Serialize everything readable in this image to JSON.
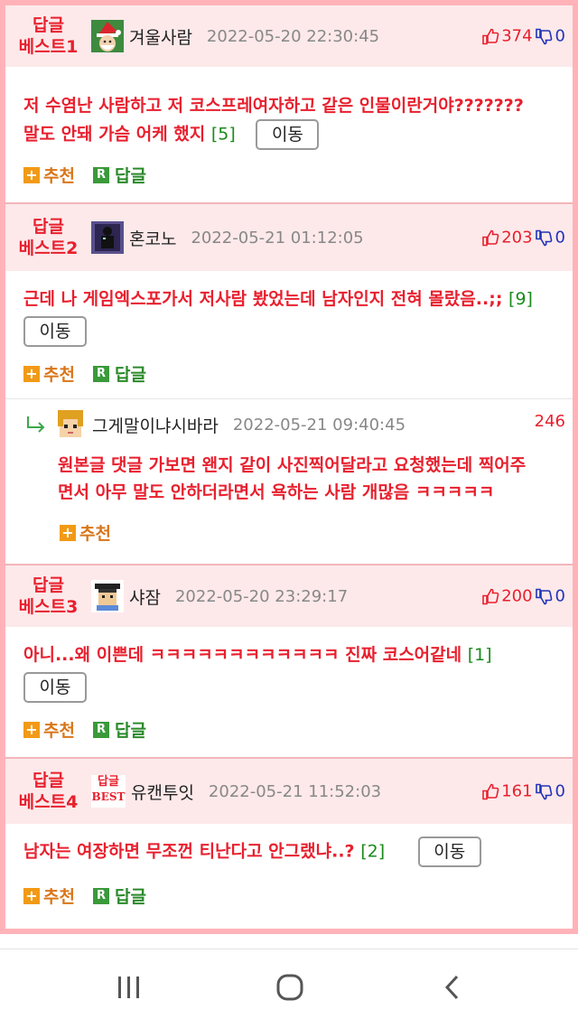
{
  "labels": {
    "recommend": "추천",
    "reply": "답글",
    "move": "이동",
    "r_badge": "R",
    "plus_badge": "+"
  },
  "colors": {
    "frame": "#ffb3b8",
    "header_bg": "#fde9ea",
    "accent_red": "#e8202e",
    "count_green": "#1a8a1a",
    "vote_down_blue": "#2133b8",
    "recommend_orange": "#d9761a",
    "reply_green": "#2b8a2b"
  },
  "comments": [
    {
      "best_line1": "답글",
      "best_line2": "베스트1",
      "avatar_icon": "santa-avatar-icon",
      "nickname": "겨울사람",
      "date": "2022-05-20 22:30:45",
      "up": "374",
      "down": "0",
      "text1": "저 수염난 사람하고 저 코스프레여자하고 같은 인물이란거야???????",
      "text2": "말도 안돼 가슴 어케 했지",
      "count": "[5]"
    },
    {
      "best_line1": "답글",
      "best_line2": "베스트2",
      "avatar_icon": "dark-figure-avatar-icon",
      "nickname": "혼코노",
      "date": "2022-05-21 01:12:05",
      "up": "203",
      "down": "0",
      "text1": "근데 나 게임엑스포가서 저사람 봤었는데 남자인지 전혀 몰랐음..;;",
      "count": "[9]"
    },
    {
      "best_line1": "답글",
      "best_line2": "베스트3",
      "avatar_icon": "pixel-man-avatar-icon",
      "nickname": "샤잠",
      "date": "2022-05-20 23:29:17",
      "up": "200",
      "down": "0",
      "text1": "아니...왜 이쁜데 ㅋㅋㅋㅋㅋㅋㅋㅋㅋㅋㅋㅋ 진짜 코스어같네",
      "count": "[1]"
    },
    {
      "best_line1": "답글",
      "best_line2": "베스트4",
      "badge_line1": "답글",
      "badge_line2": "BEST",
      "nickname": "유캔투잇",
      "date": "2022-05-21 11:52:03",
      "up": "161",
      "down": "0",
      "text1": "남자는 여장하면 무조껀 티난다고 안그랬냐..?",
      "count": "[2]"
    }
  ],
  "reply": {
    "avatar_icon": "pixel-boy-avatar-icon",
    "nickname": "그게말이냐시바라",
    "date": "2022-05-21 09:40:45",
    "score": "246",
    "text1": "원본글 댓글 가보면 왠지 같이 사진찍어달라고 요청했는데 찍어주",
    "text2": "면서 아무 말도 안하더라면서 욕하는 사람 개많음 ㅋㅋㅋㅋㅋ"
  },
  "navbar": {
    "recent_icon": "recent-apps-icon",
    "home_icon": "home-icon",
    "back_icon": "back-icon"
  }
}
